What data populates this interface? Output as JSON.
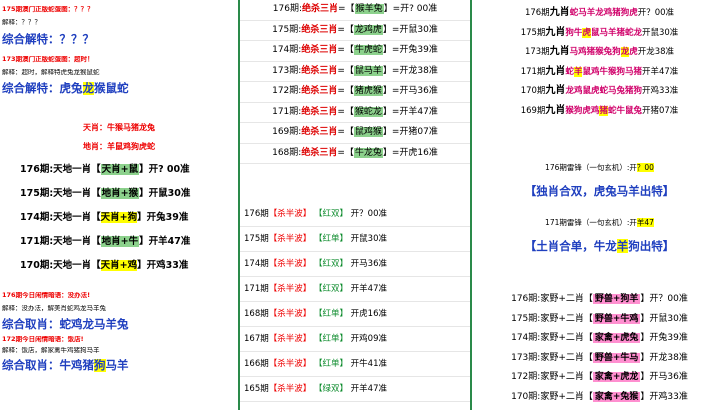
{
  "col1": {
    "top_note_1": "175期澳门正版蛇蛋图：？？？",
    "top_note_1_sub": "解释：？？？",
    "top_title_1": "综合解特：？？？",
    "top_note_2": "173期澳门正版蛇蛋图：超时！",
    "top_note_2_sub": "解释：超时，解释特虎兔龙猴鼠蛇",
    "top_title_2_prefix": "综合解特：虎兔",
    "top_title_2_hl": "龙",
    "top_title_2_suffix": "猴鼠蛇",
    "tianxiao": "天肖：牛猴马猪龙兔",
    "dixiao": "地肖：羊鼠鸡狗虎蛇",
    "rows": [
      {
        "lead": "176期:天地一肖【",
        "tag": "天肖+鼠",
        "tag_color": "g",
        "tail": "】开? 00准"
      },
      {
        "lead": "175期:天地一肖【",
        "tag": "地肖+猴",
        "tag_color": "g",
        "tail": "】开鼠30准"
      },
      {
        "lead": "174期:天地一肖【",
        "tag": "天肖+狗",
        "tag_color": "y",
        "tail": "】开兔39准"
      },
      {
        "lead": "171期:天地一肖【",
        "tag": "地肖+牛",
        "tag_color": "g",
        "tail": "】开羊47准"
      },
      {
        "lead": "170期:天地一肖【",
        "tag": "天肖+鸡",
        "tag_color": "y",
        "tail": "】开鸡33准"
      }
    ],
    "bottom_note_1": "176期今日闲情暗语：没办法!",
    "bottom_note_1_sub": "解释：没办法，解美肖蛇鸡龙马羊兔",
    "bottom_title_1": "综合取肖：蛇鸡龙马羊兔",
    "bottom_note_2": "172期今日闲情暗语：饭店!",
    "bottom_note_2_sub": "解释：饭店，解家禽牛鸡猪狗马羊",
    "bottom_title_2_prefix": "综合取肖：牛鸡猪",
    "bottom_title_2_hl": "狗",
    "bottom_title_2_suffix": "马羊"
  },
  "col2": {
    "rows_a": [
      {
        "lead": "176期:",
        "bold": "绝杀三肖",
        "mid": "=【",
        "tag": "猴羊兔",
        "tail": "】=开? 00准"
      },
      {
        "lead": "175期:",
        "bold": "绝杀三肖",
        "mid": "=【",
        "tag": "龙鸡虎",
        "tail": "】=开鼠30准"
      },
      {
        "lead": "174期:",
        "bold": "绝杀三肖",
        "mid": "=【",
        "tag": "牛虎蛇",
        "tail": "】=开兔39准"
      },
      {
        "lead": "173期:",
        "bold": "绝杀三肖",
        "mid": "=【",
        "tag": "鼠马羊",
        "tail": "】=开龙38准"
      },
      {
        "lead": "172期:",
        "bold": "绝杀三肖",
        "mid": "=【",
        "tag": "猪虎猴",
        "tail": "】=开马36准"
      },
      {
        "lead": "171期:",
        "bold": "绝杀三肖",
        "mid": "=【",
        "tag": "猴蛇龙",
        "tail": "】=开羊47准"
      },
      {
        "lead": "169期:",
        "bold": "绝杀三肖",
        "mid": "=【",
        "tag": "鼠鸡猴",
        "tail": "】=开猪07准"
      },
      {
        "lead": "168期:",
        "bold": "绝杀三肖",
        "mid": "=【",
        "tag": "牛龙兔",
        "tail": "】=开虎16准"
      }
    ],
    "rows_b": [
      {
        "lead": "176期",
        "p1": "【杀半波】",
        "p2": "【红双】",
        "tail": "开？00准"
      },
      {
        "lead": "175期",
        "p1": "【杀半波】",
        "p2": "【红单】",
        "tail": "开鼠30准"
      },
      {
        "lead": "174期",
        "p1": "【杀半波】",
        "p2": "【红双】",
        "tail": "开马36准"
      },
      {
        "lead": "171期",
        "p1": "【杀半波】",
        "p2": "【红双】",
        "tail": "开羊47准"
      },
      {
        "lead": "168期",
        "p1": "【杀半波】",
        "p2": "【红单】",
        "tail": "开虎16准"
      },
      {
        "lead": "167期",
        "p1": "【杀半波】",
        "p2": "【红单】",
        "tail": "开鸡09准"
      },
      {
        "lead": "166期",
        "p1": "【杀半波】",
        "p2": "【红单】",
        "tail": "开牛41准"
      },
      {
        "lead": "165期",
        "p1": "【杀半波】",
        "p2": "【绿双】",
        "tail": "开羊47准"
      }
    ]
  },
  "col3": {
    "rows_a": [
      {
        "lead": "176期",
        "bold": "九肖",
        "names": "蛇马羊龙鸡猪狗虎",
        "hl": "",
        "tail": "开？00准"
      },
      {
        "lead": "175期",
        "bold": "九肖",
        "names": "狗牛",
        "hl": "虎",
        "names2": "鼠马羊猪蛇龙",
        "tail": "开鼠30准"
      },
      {
        "lead": "173期",
        "bold": "九肖",
        "names": "马鸡猪猴兔狗",
        "hl": "龙",
        "names2": "虎",
        "tail": "开龙38准"
      },
      {
        "lead": "171期",
        "bold": "九肖",
        "names": "蛇",
        "hl": "羊",
        "names2": "鼠鸡牛猴狗马猪",
        "tail": "开羊47准"
      },
      {
        "lead": "170期",
        "bold": "九肖",
        "names": "龙鸡鼠虎蛇马兔猪狗",
        "hl": "",
        "tail": "开鸡33准"
      },
      {
        "lead": "169期",
        "bold": "九肖",
        "names": "猴狗虎鸡",
        "hl": "猪",
        "names2": "蛇牛鼠兔",
        "tail": "开猪07准"
      }
    ],
    "thunder_1_lead": "176期雷锋（一句玄机）:",
    "thunder_1_tail": "开",
    "thunder_1_hl": "？00",
    "thunder_1_title": "【独肖合双，虎兔马羊出特】",
    "thunder_2_lead": "171期雷锋（一句玄机）:",
    "thunder_2_tail": "开",
    "thunder_2_hl": "羊47",
    "thunder_2_title_prefix": "【土肖合单，牛龙",
    "thunder_2_title_hl": "羊",
    "thunder_2_title_suffix": "狗出特】",
    "rows_b": [
      {
        "lead": "176期:家野+二肖【",
        "tag": "野兽+狗羊",
        "tail": "】开？00准"
      },
      {
        "lead": "175期:家野+二肖【",
        "tag": "野兽+牛鸡",
        "tail": "】开鼠30准"
      },
      {
        "lead": "174期:家野+二肖【",
        "tag": "家禽+虎兔",
        "tail": "】开兔39准"
      },
      {
        "lead": "173期:家野+二肖【",
        "tag": "野兽+牛马",
        "tail": "】开龙38准"
      },
      {
        "lead": "172期:家野+二肖【",
        "tag": "家禽+虎龙",
        "tail": "】开马36准"
      },
      {
        "lead": "170期:家野+二肖【",
        "tag": "家禽+兔猴",
        "tail": "】开鸡33准"
      }
    ]
  }
}
